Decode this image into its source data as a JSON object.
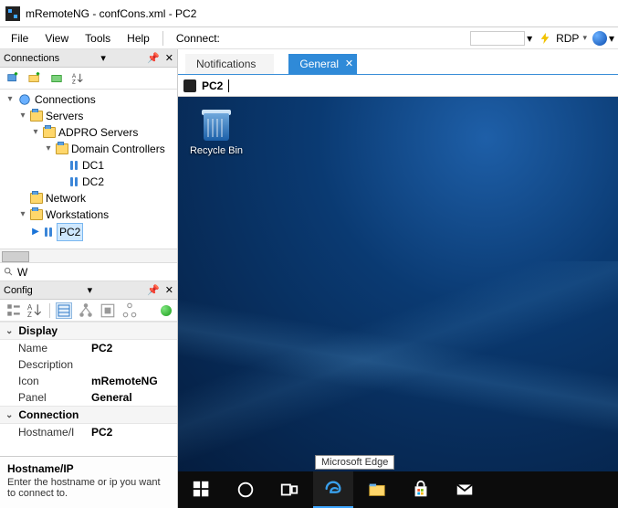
{
  "window": {
    "title": "mRemoteNG - confCons.xml - PC2"
  },
  "menu": {
    "file": "File",
    "view": "View",
    "tools": "Tools",
    "help": "Help",
    "connect_label": "Connect:",
    "protocol": "RDP"
  },
  "panels": {
    "connections_title": "Connections",
    "config_title": "Config"
  },
  "tree": {
    "root": "Connections",
    "servers": "Servers",
    "adpro": "ADPRO Servers",
    "dcs": "Domain Controllers",
    "dc1": "DC1",
    "dc2": "DC2",
    "network": "Network",
    "workstations": "Workstations",
    "pc2": "PC2"
  },
  "search": {
    "value": "W"
  },
  "properties": {
    "cat_display": "Display",
    "name_k": "Name",
    "name_v": "PC2",
    "desc_k": "Description",
    "desc_v": "",
    "icon_k": "Icon",
    "icon_v": "mRemoteNG",
    "panel_k": "Panel",
    "panel_v": "General",
    "cat_conn": "Connection",
    "host_k": "Hostname/I",
    "host_v": "PC2"
  },
  "help": {
    "title": "Hostname/IP",
    "body": "Enter the hostname or ip you want to connect to."
  },
  "tabs": {
    "notifications": "Notifications",
    "general": "General"
  },
  "session": {
    "label": "PC2"
  },
  "desktop": {
    "recycle": "Recycle Bin",
    "tooltip": "Microsoft Edge"
  }
}
